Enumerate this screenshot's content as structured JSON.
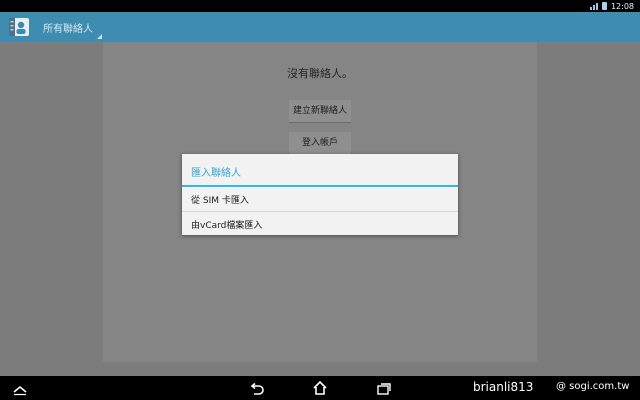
{
  "status_bar": {
    "time": "12:08",
    "signal_icon": "signal-icon",
    "battery_icon": "battery-icon"
  },
  "action_bar": {
    "title": "所有聯絡人",
    "app_icon": "contacts-app-icon"
  },
  "main": {
    "empty_message": "沒有聯絡人。",
    "create_contact_label": "建立新聯絡人",
    "login_account_label": "登入帳戶"
  },
  "dialog": {
    "title": "匯入聯絡人",
    "items": [
      {
        "label": "從 SIM 卡匯入"
      },
      {
        "label": "由vCard檔案匯入"
      }
    ],
    "accent_color": "#33b5e5"
  },
  "nav_bar": {
    "icons": [
      "collapse-icon",
      "back-icon",
      "home-icon",
      "recent-apps-icon"
    ]
  },
  "watermark": {
    "user": "brianli813",
    "site": "@ sogi.com.tw"
  }
}
